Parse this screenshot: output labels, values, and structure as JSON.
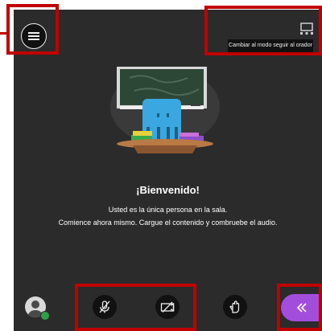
{
  "follow_speaker": {
    "label": "Cambiar al modo seguir al orador",
    "icon": "monitor-icon"
  },
  "welcome": {
    "title": "¡Bienvenido!",
    "line1": "Usted es la única persona en la sala.",
    "line2": "Comience ahora mismo. Cargue el contenido y combruebe el audio."
  },
  "toolbar": {
    "menu_icon": "hamburger-menu-icon",
    "mic_icon": "microphone-off-icon",
    "camera_icon": "camera-off-icon",
    "raise_hand_icon": "raise-hand-icon",
    "panel_toggle_icon": "double-chevron-left-icon"
  },
  "user": {
    "status": "connected"
  },
  "colors": {
    "background": "#2b2b2b",
    "button": "#111111",
    "accent": "#a34ddd",
    "highlight": "#c00000",
    "status": "#2e9f46"
  }
}
